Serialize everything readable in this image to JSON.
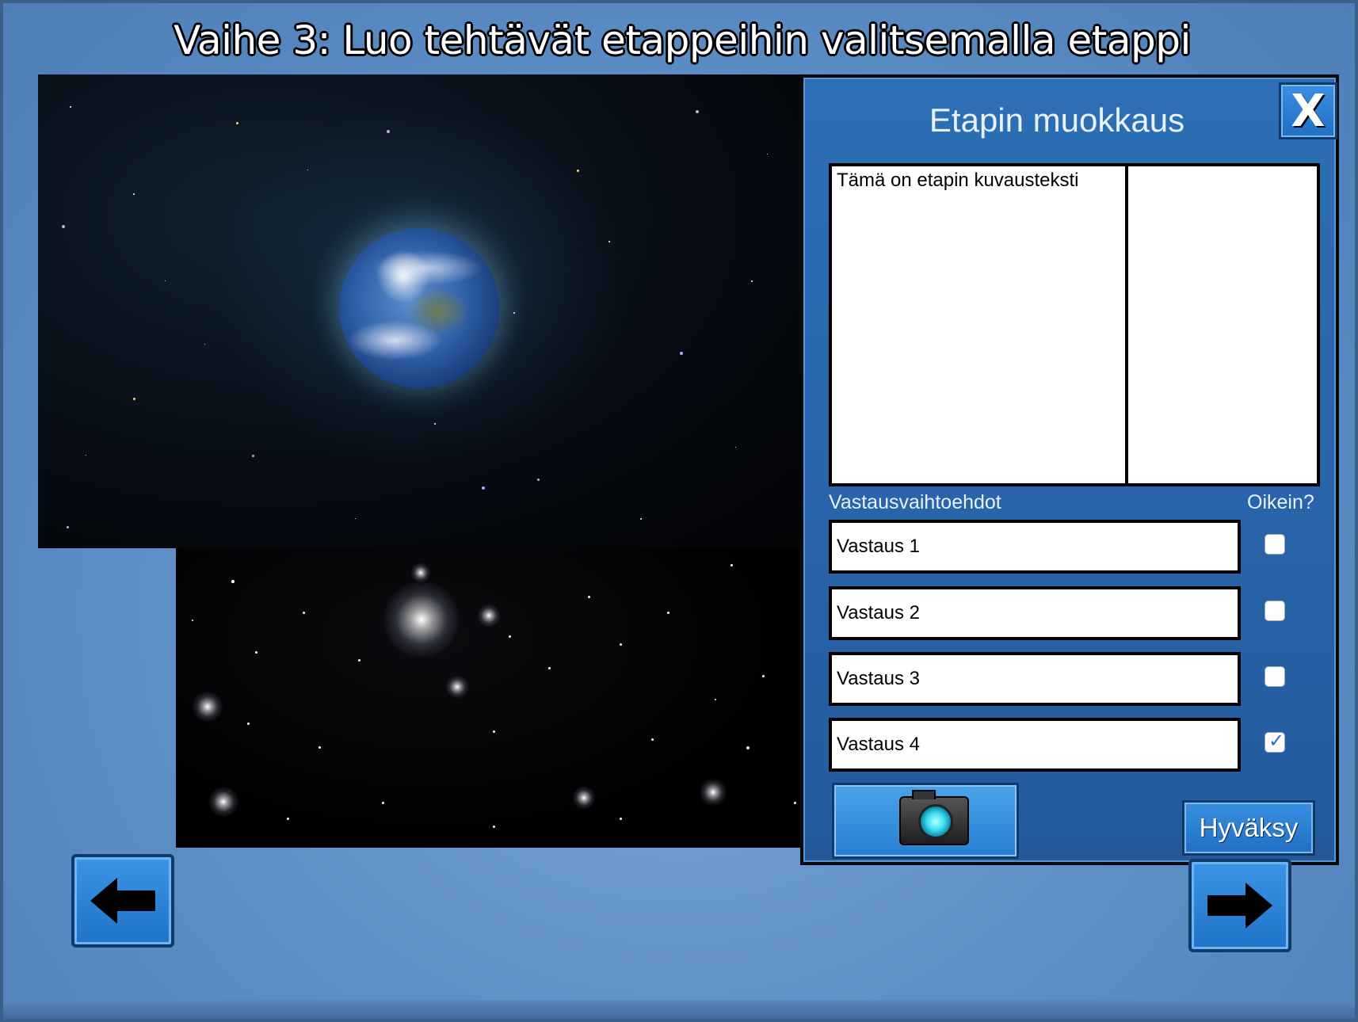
{
  "header": {
    "title": "Vaihe 3: Luo tehtävät etappeihin valitsemalla etappi"
  },
  "editor": {
    "title": "Etapin muokkaus",
    "close_label": "X",
    "description": "Tämä on etapin kuvausteksti",
    "answers_label": "Vastausvaihtoehdot",
    "correct_label": "Oikein?",
    "answers": [
      {
        "text": "Vastaus 1",
        "correct": false
      },
      {
        "text": "Vastaus 2",
        "correct": false
      },
      {
        "text": "Vastaus 3",
        "correct": false
      },
      {
        "text": "Vastaus 4",
        "correct": true
      }
    ],
    "camera_icon": "camera-icon",
    "approve_label": "Hyväksy"
  },
  "navigation": {
    "prev_icon": "arrow-left-icon",
    "next_icon": "arrow-right-icon"
  },
  "colors": {
    "background": "#5e8ec6",
    "panel": "#2a67ad",
    "button": "#2a7fd0",
    "checkmark": "#2a6ed4"
  }
}
